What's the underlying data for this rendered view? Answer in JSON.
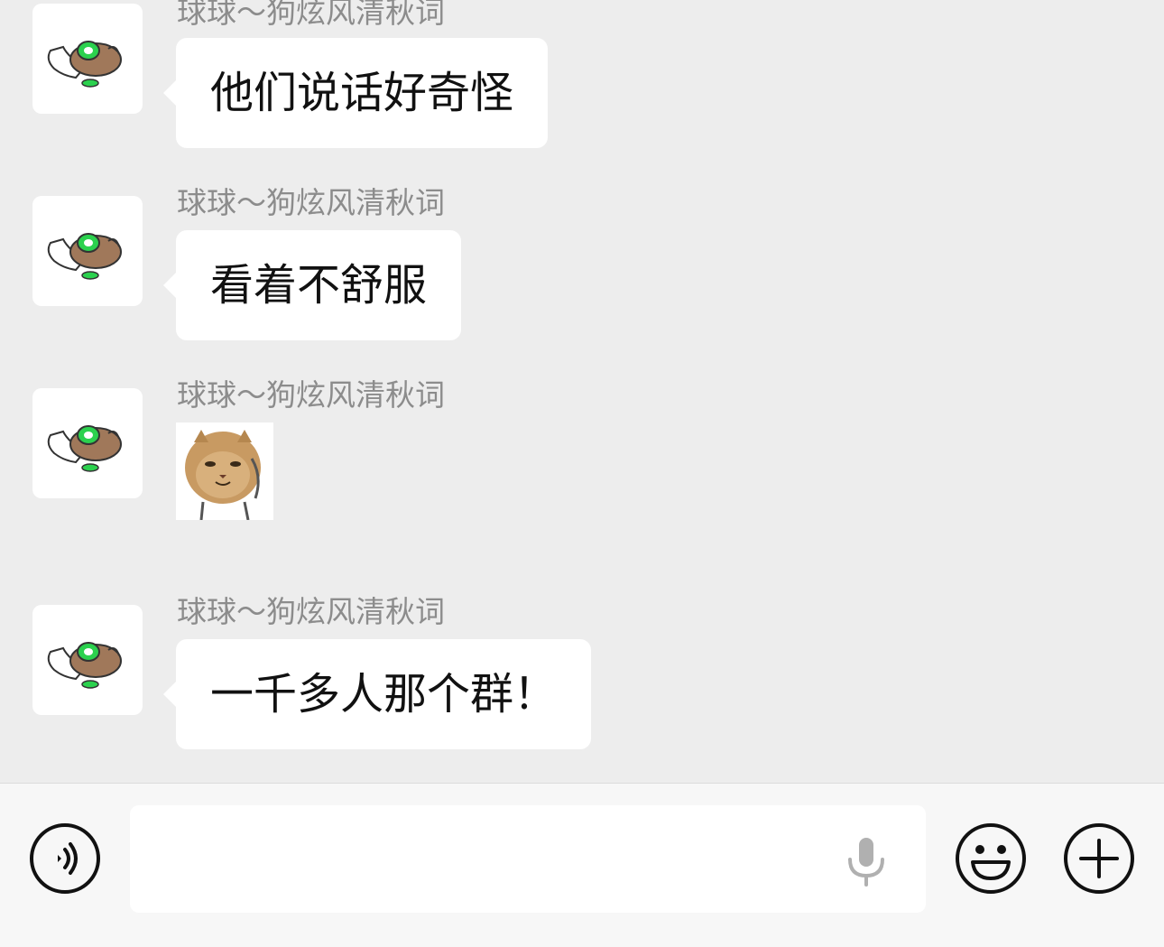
{
  "chat": {
    "messages": [
      {
        "sender": "球球～狗炫风清秋词",
        "type": "text",
        "text": "他们说话好奇怪"
      },
      {
        "sender": "球球～狗炫风清秋词",
        "type": "text",
        "text": "看着不舒服"
      },
      {
        "sender": "球球～狗炫风清秋词",
        "type": "sticker",
        "sticker_icon": "cat-face-sticker"
      },
      {
        "sender": "球球～狗炫风清秋词",
        "type": "text",
        "text": "一千多人那个群！"
      }
    ],
    "avatar_icon": "sleeping-dog-avatar"
  },
  "input_bar": {
    "voice_icon": "voice-mode-icon",
    "text_value": "",
    "mic_icon": "microphone-icon",
    "emoji_icon": "smiley-icon",
    "plus_icon": "plus-icon"
  },
  "colors": {
    "background": "#ededed",
    "bubble": "#ffffff",
    "sender_name": "#8c8c8c",
    "input_bar": "#f7f7f7"
  }
}
